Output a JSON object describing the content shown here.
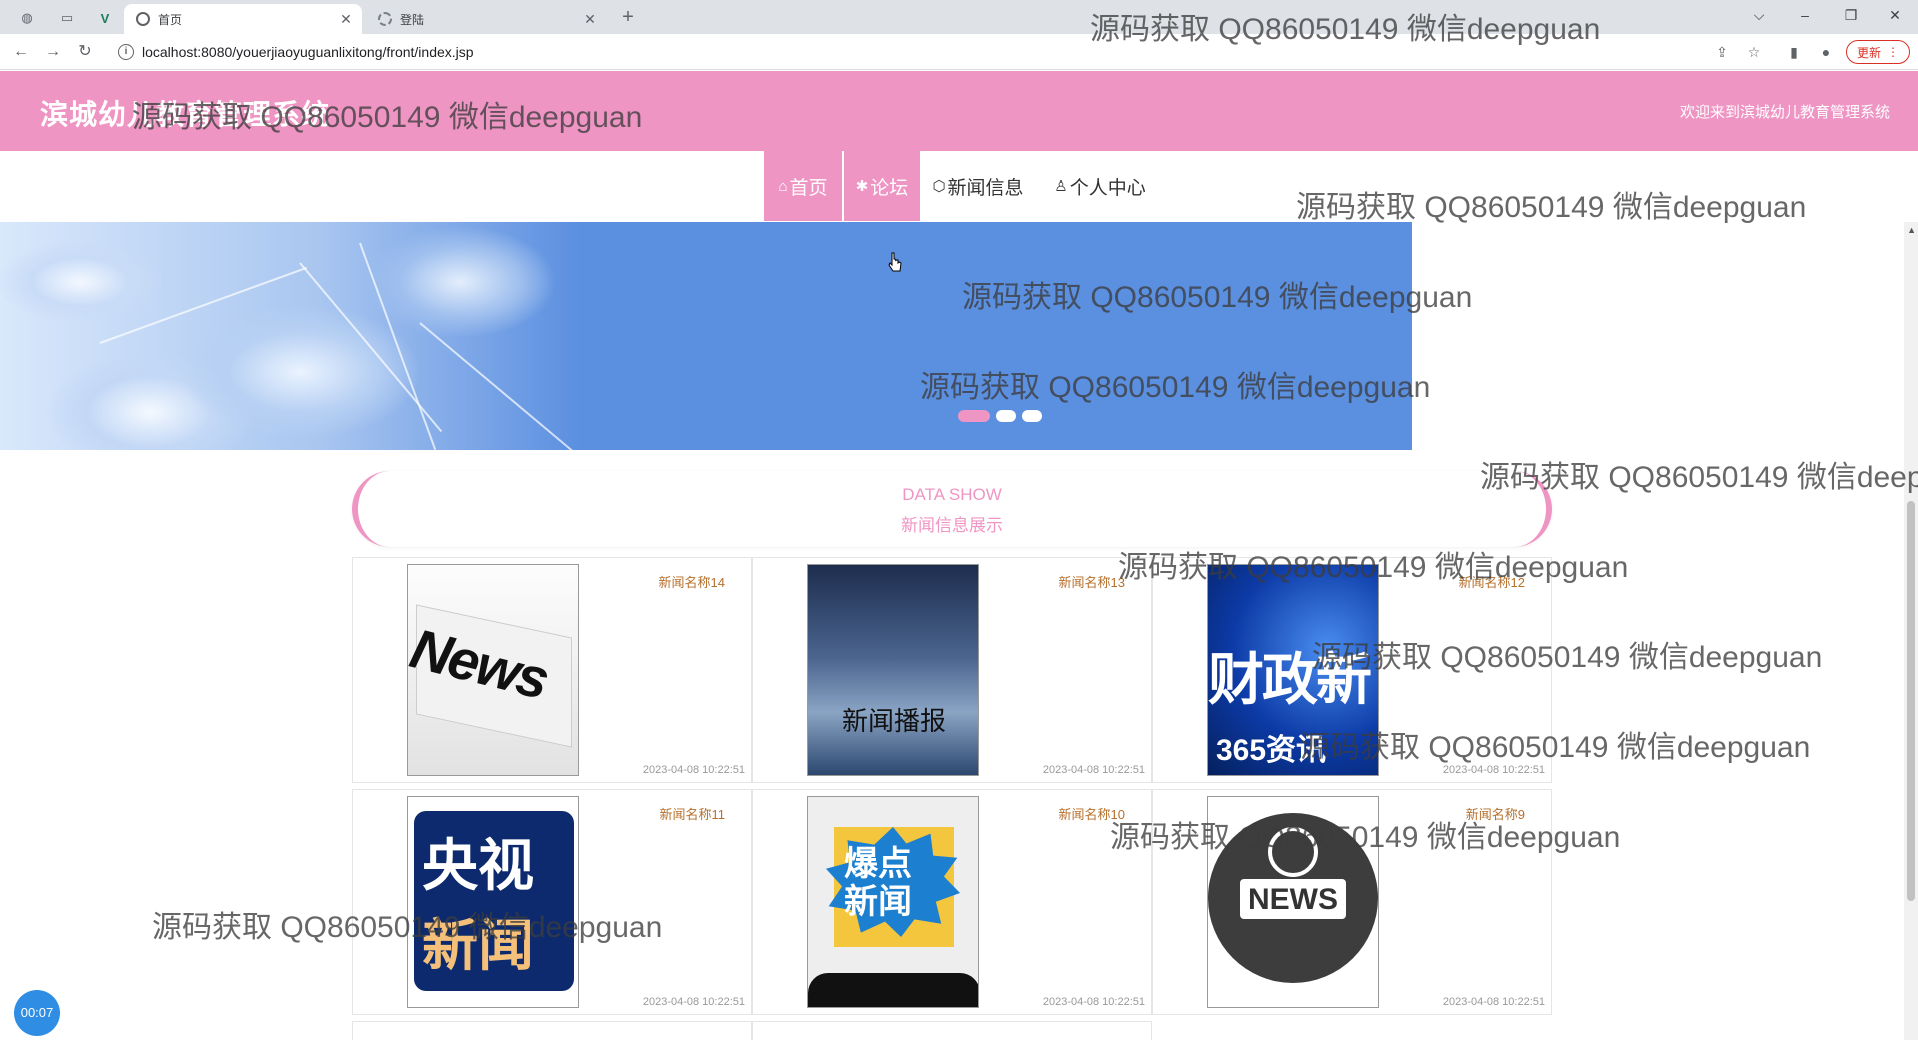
{
  "browser": {
    "tabs": [
      {
        "title": "首页",
        "active": true
      },
      {
        "title": "登陆",
        "active": false
      }
    ],
    "new_tab": "+",
    "url": "localhost:8080/youerjiaoyuguanlixitong/front/index.jsp",
    "update_label": "更新",
    "controls": {
      "minimize": "–",
      "restore": "❐",
      "close": "✕",
      "menu": "⌵"
    }
  },
  "header": {
    "site_title": "滨城幼儿教育管理系统",
    "welcome": "欢迎来到滨城幼儿教育管理系统"
  },
  "nav": [
    {
      "icon": "⌂",
      "label": "首页"
    },
    {
      "icon": "✱",
      "label": "论坛"
    },
    {
      "icon": "⬡",
      "label": "新闻信息"
    },
    {
      "icon": "♙",
      "label": "个人中心"
    }
  ],
  "section": {
    "en": "DATA SHOW",
    "zh": "新闻信息展示"
  },
  "news": [
    {
      "name": "新闻名称14",
      "time": "2023-04-08 10:22:51",
      "image": "news-newspaper"
    },
    {
      "name": "新闻名称13",
      "time": "2023-04-08 10:22:51",
      "image": "news-broadcast",
      "image_text": "新闻播报"
    },
    {
      "name": "新闻名称12",
      "time": "2023-04-08 10:22:51",
      "image": "finance-news",
      "image_text": "财政新",
      "image_text2": "365资讯"
    },
    {
      "name": "新闻名称11",
      "time": "2023-04-08 10:22:51",
      "image": "cctv-news",
      "image_text": "央视",
      "image_text2": "新闻"
    },
    {
      "name": "新闻名称10",
      "time": "2023-04-08 10:22:51",
      "image": "hot-news",
      "image_text": "爆点新闻"
    },
    {
      "name": "新闻名称9",
      "time": "2023-04-08 10:22:51",
      "image": "globe-news",
      "image_text": "NEWS"
    }
  ],
  "recorder": "00:07",
  "watermark": "源码获取 QQ86050149 微信deepguan",
  "colors": {
    "accent": "#ef95c4",
    "banner": "#5b8fe0",
    "news_name": "#b5702d"
  }
}
